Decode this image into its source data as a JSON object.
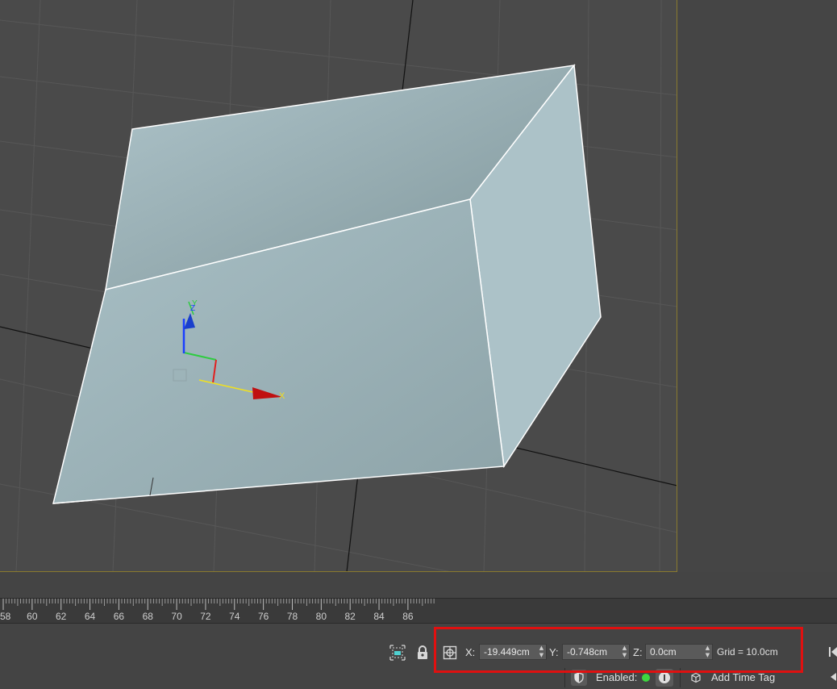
{
  "viewport": {
    "axis_labels": {
      "x": "X",
      "y": "Y",
      "z": "Z"
    },
    "colors": {
      "background": "#4a4a4a",
      "object_fill": "#9fb6bb",
      "grid": "#5a5a5a",
      "frame": "#8a7a2e"
    }
  },
  "timeline": {
    "ticks": [
      "58",
      "60",
      "62",
      "64",
      "66",
      "68",
      "70",
      "72",
      "74",
      "76",
      "78",
      "80",
      "82",
      "84",
      "86"
    ]
  },
  "status_bar": {
    "selection_icon": "select-object-icon",
    "lock_icon": "lock-icon",
    "transform_mode_icon": "absolute-mode-icon",
    "x_label": "X:",
    "x_value": "-19.449cm",
    "y_label": "Y:",
    "y_value": "-0.748cm",
    "z_label": "Z:",
    "z_value": "0.0cm",
    "grid_text": "Grid = 10.0cm",
    "enabled_label": "Enabled:",
    "enabled_color": "#3fd63f",
    "add_time_tag": "Add Time Tag",
    "highlight_color": "#e01010"
  }
}
